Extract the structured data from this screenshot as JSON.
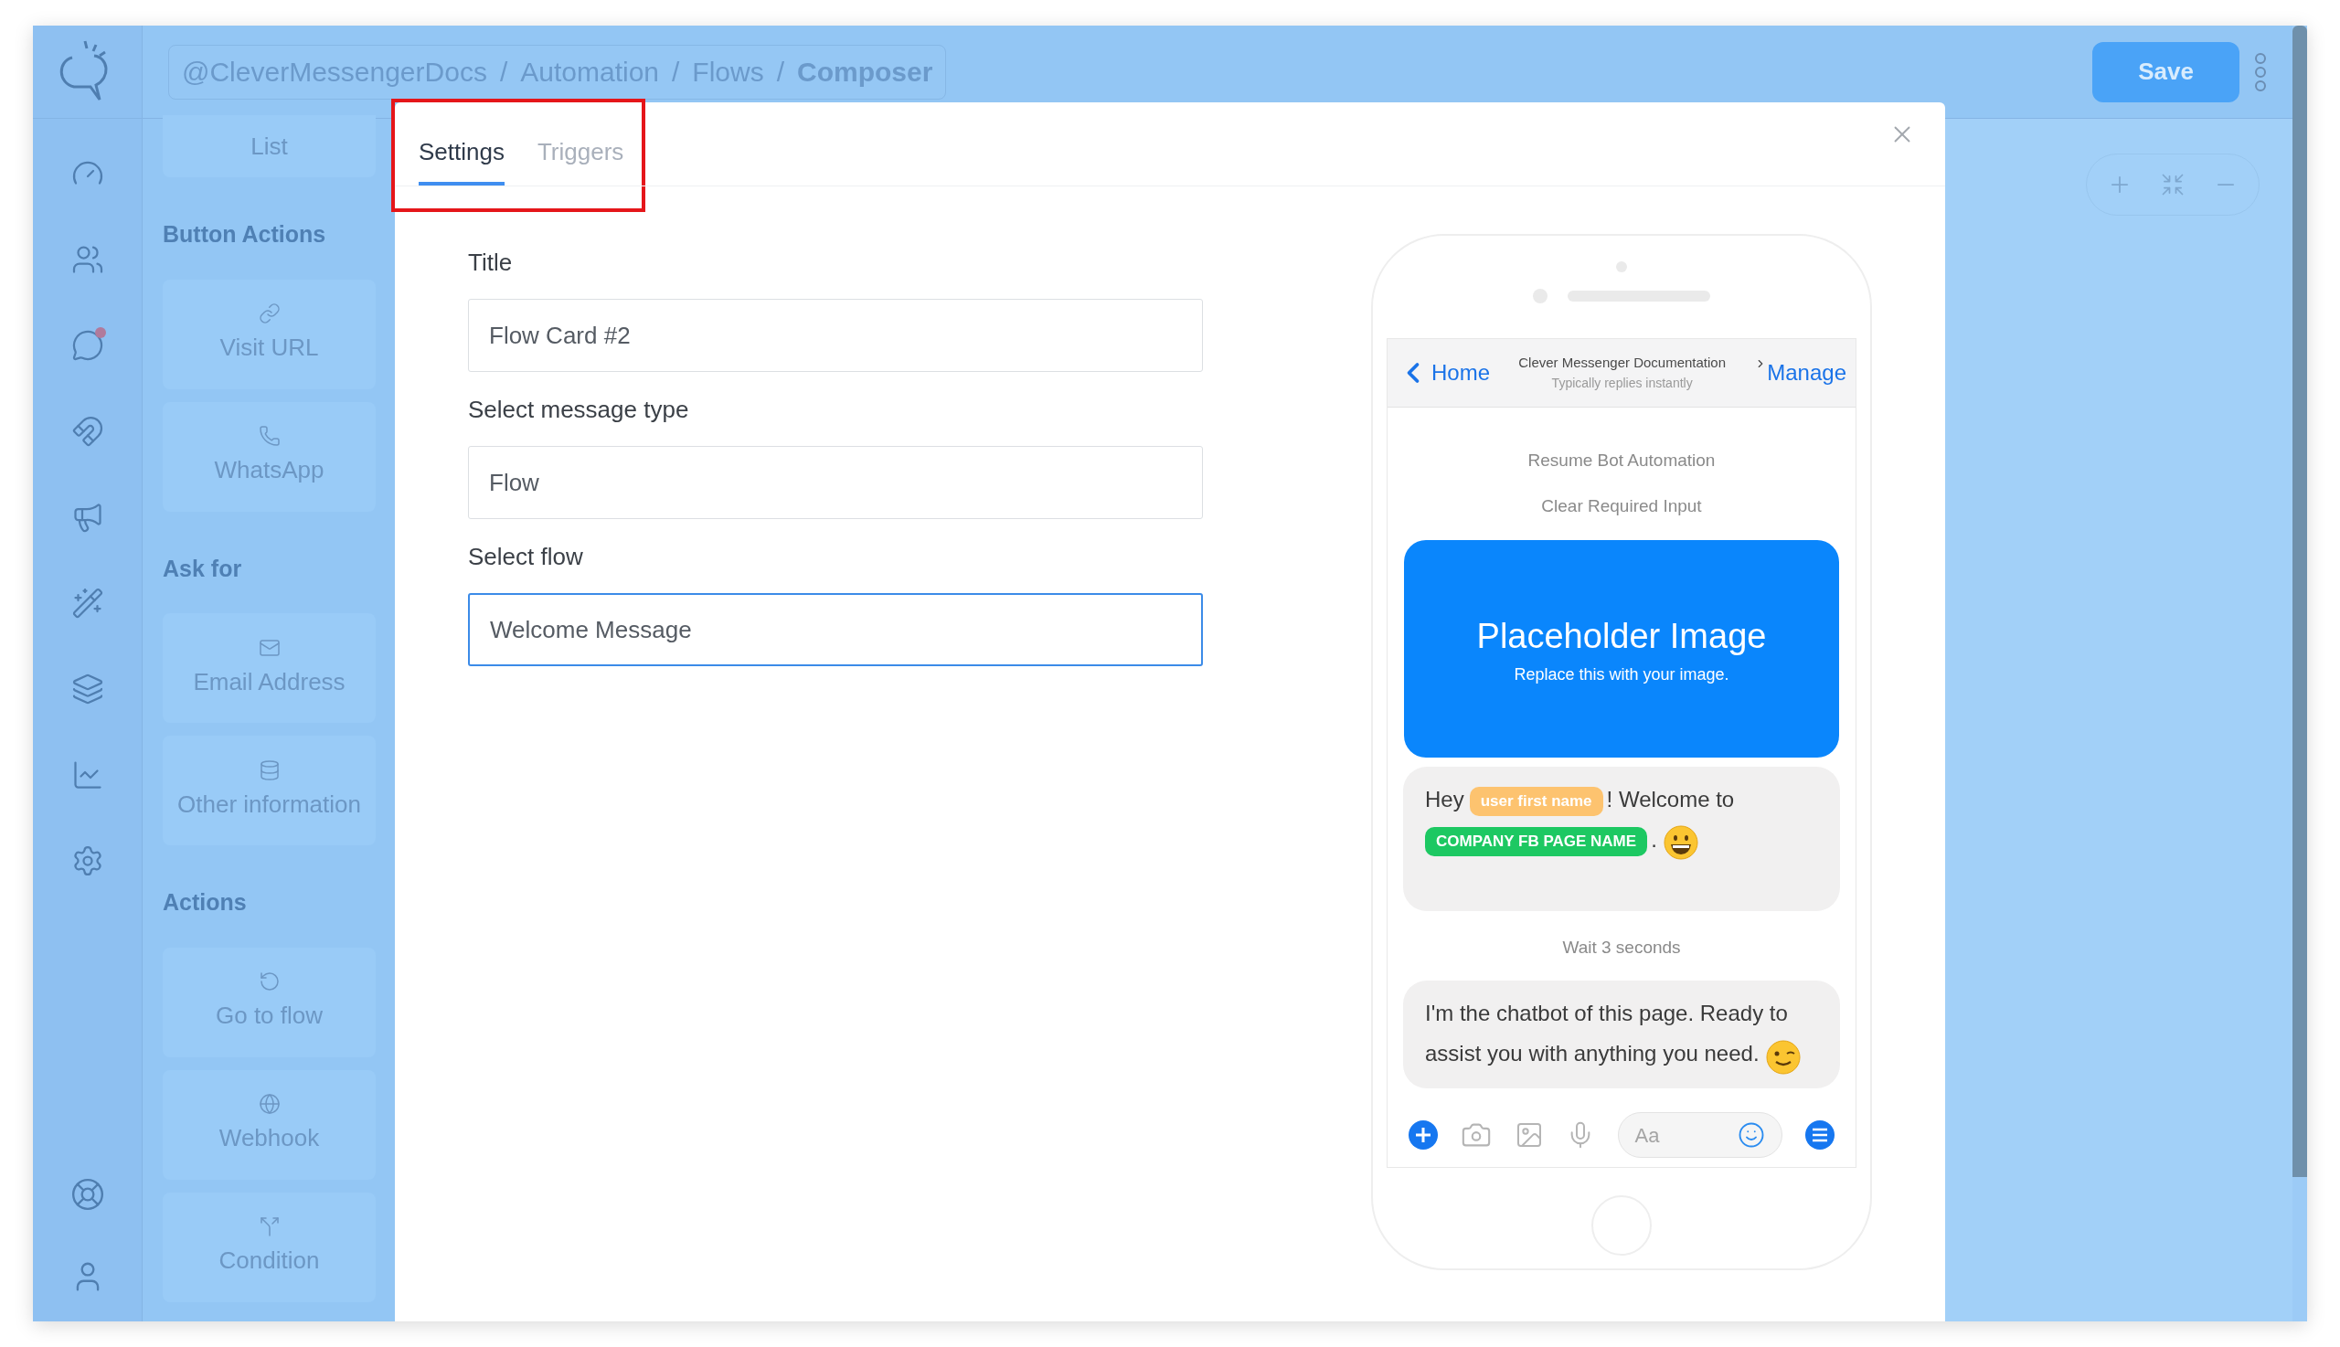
{
  "header": {
    "breadcrumb": [
      "@CleverMessengerDocs",
      "Automation",
      "Flows",
      "Composer"
    ],
    "separator": "/",
    "save": "Save"
  },
  "palette": {
    "top_item": "List",
    "sections": [
      {
        "title": "Button Actions",
        "items": [
          "Visit URL",
          "WhatsApp"
        ]
      },
      {
        "title": "Ask for",
        "items": [
          "Email Address",
          "Other information"
        ]
      },
      {
        "title": "Actions",
        "items": [
          "Go to flow",
          "Webhook",
          "Condition"
        ]
      }
    ]
  },
  "modal": {
    "tabs": [
      {
        "label": "Settings",
        "selected": true
      },
      {
        "label": "Triggers",
        "selected": false
      }
    ],
    "fields": [
      {
        "label": "Title",
        "value": "Flow Card #2",
        "focused": false
      },
      {
        "label": "Select message type",
        "value": "Flow",
        "focused": false
      },
      {
        "label": "Select flow",
        "value": "Welcome Message",
        "focused": true
      }
    ]
  },
  "preview": {
    "back": "Home",
    "page_name": "Clever Messenger Documentation",
    "status": "Typically replies instantly",
    "manage": "Manage",
    "timeline": [
      {
        "kind": "event",
        "text": "Resume Bot Automation"
      },
      {
        "kind": "event",
        "text": "Clear Required Input"
      },
      {
        "kind": "image",
        "title": "Placeholder Image",
        "subtitle": "Replace this with your image."
      },
      {
        "kind": "message",
        "segments": [
          {
            "kind": "text",
            "text": "Hey"
          },
          {
            "kind": "tag",
            "text": "user first name",
            "color": "#fdc36f"
          },
          {
            "kind": "text",
            "text": "! Welcome to"
          },
          {
            "kind": "tag",
            "text": "COMPANY FB PAGE NAME",
            "color": "#1dc862"
          },
          {
            "kind": "text",
            "text": "."
          },
          {
            "kind": "grin"
          }
        ]
      },
      {
        "kind": "event",
        "text": "Wait 3 seconds"
      },
      {
        "kind": "message",
        "segments": [
          {
            "kind": "text",
            "text": "I'm the chatbot of this page. Ready to assist you with anything you need."
          },
          {
            "kind": "wink"
          }
        ]
      }
    ],
    "composer_placeholder": "Aa"
  }
}
